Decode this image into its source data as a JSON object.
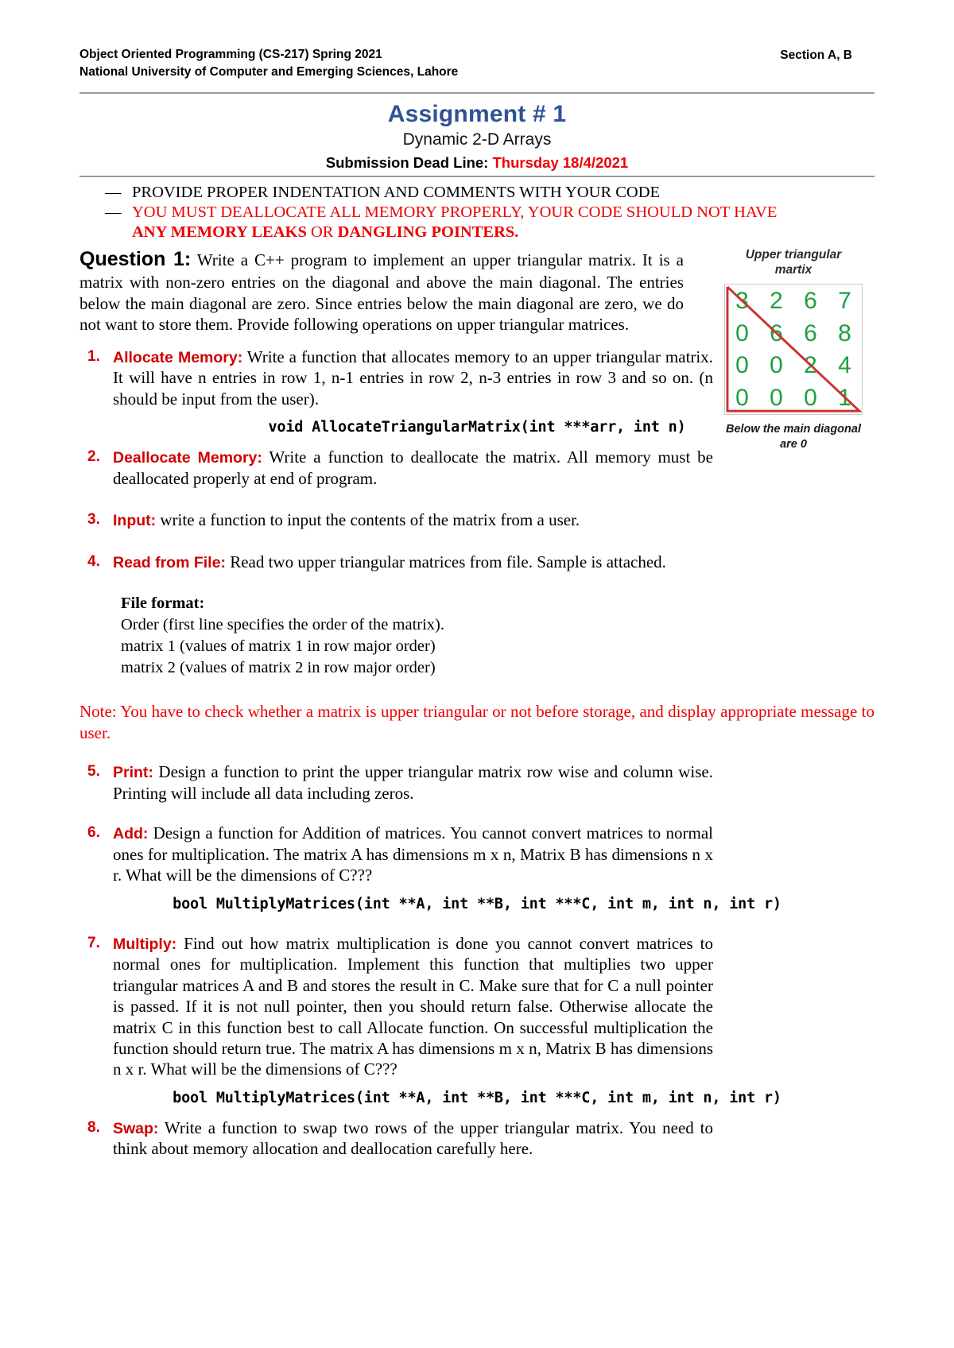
{
  "header": {
    "course_line": "Object Oriented Programming (CS-217) Spring 2021",
    "university_line": "National University of Computer and Emerging Sciences, Lahore",
    "section": "Section A, B"
  },
  "title": {
    "assignment": "Assignment # 1",
    "subtitle": "Dynamic 2-D Arrays",
    "deadline_label": "Submission Dead Line:",
    "deadline_date": "Thursday 18/4/2021"
  },
  "notices": {
    "dash": "—",
    "line1": "PROVIDE PROPER INDENTATION AND COMMENTS WITH YOUR CODE",
    "line2a": "YOU MUST DEALLOCATE ALL MEMORY PROPERLY, YOUR CODE SHOULD NOT HAVE",
    "line2b_bold1": "ANY MEMORY LEAKS",
    "line2b_mid": " OR ",
    "line2b_bold2": "DANGLING POINTERS."
  },
  "question": {
    "label": "Question 1:",
    "text": "Write a C++ program to implement an upper triangular matrix. It is a matrix with non-zero entries on the diagonal and above the main diagonal. The entries below the main diagonal are zero. Since entries below the main diagonal are zero, we do not want to store them. Provide following operations on upper triangular matrices."
  },
  "figure": {
    "caption_top": "Upper triangular martix",
    "caption_top_line1": "Upper triangular",
    "caption_top_line2": "martix",
    "caption_bottom_line1": "Below the main diagonal",
    "caption_bottom_line2": "are 0",
    "number_color": "#1f9f3e",
    "triangle_color": "#cc3333",
    "matrix": [
      [
        "3",
        "2",
        "6",
        "7"
      ],
      [
        "0",
        "6",
        "6",
        "8"
      ],
      [
        "0",
        "0",
        "2",
        "4"
      ],
      [
        "0",
        "0",
        "0",
        "1"
      ]
    ]
  },
  "items": [
    {
      "num": "1.",
      "label": "Allocate Memory:",
      "text": " Write a function that allocates memory to an upper triangular matrix.  It will have n entries in row 1, n-1 entries in row 2, n-3 entries in row 3 and so on.  (n should be input from the user).",
      "code": "void AllocateTriangularMatrix(int ***arr, int n)"
    },
    {
      "num": "2.",
      "label": "Deallocate Memory:",
      "text": " Write a function to deallocate the matrix. All memory must be deallocated properly at end of program.",
      "code": ""
    },
    {
      "num": "3.",
      "label": "Input:",
      "text": " write a function to input the contents of the matrix from a user.",
      "code": ""
    },
    {
      "num": "4.",
      "label": "Read from File:",
      "text": " Read two upper triangular matrices from file.  Sample is attached.",
      "code": ""
    },
    {
      "num": "5.",
      "label": "Print:",
      "text": " Design a function to print the upper triangular matrix row wise and column wise. Printing will include all data including zeros.",
      "code": ""
    },
    {
      "num": "6.",
      "label": "Add:",
      "text": " Design a function for Addition of matrices. You cannot convert matrices to normal ones for multiplication.  The matrix A has dimensions m x n, Matrix B has dimensions n x r.  What will be the dimensions of C???",
      "code": "bool MultiplyMatrices(int **A, int **B, int ***C, int m, int n, int r)"
    },
    {
      "num": "7.",
      "label": "Multiply:",
      "text": " Find out how matrix multiplication is done you cannot convert matrices to normal ones for multiplication.  Implement this function that multiplies two upper triangular matrices A and B and stores the result in C.  Make sure that for C a null pointer is passed.  If it is not null pointer, then you should return false. Otherwise allocate the matrix C in this function best to call Allocate function.  On successful multiplication the function should return true. The matrix A has dimensions m x n, Matrix B has dimensions n x r.  What will be the dimensions of C???",
      "code": "bool MultiplyMatrices(int **A, int **B, int ***C, int m, int n, int r)"
    },
    {
      "num": "8.",
      "label": "Swap:",
      "text": " Write a function to swap two rows of the upper triangular matrix.  You need to think about memory allocation and deallocation carefully here.",
      "code": ""
    }
  ],
  "file_format": {
    "title": "File format:",
    "line1": "Order   (first line specifies the order of the matrix).",
    "line2": "matrix 1  (values of matrix 1 in row major order)",
    "line3": "matrix 2  (values of matrix 2 in row major order)"
  },
  "note": {
    "text": "Note: You have to check whether a matrix is upper triangular or not before storage, and display appropriate message to user."
  }
}
